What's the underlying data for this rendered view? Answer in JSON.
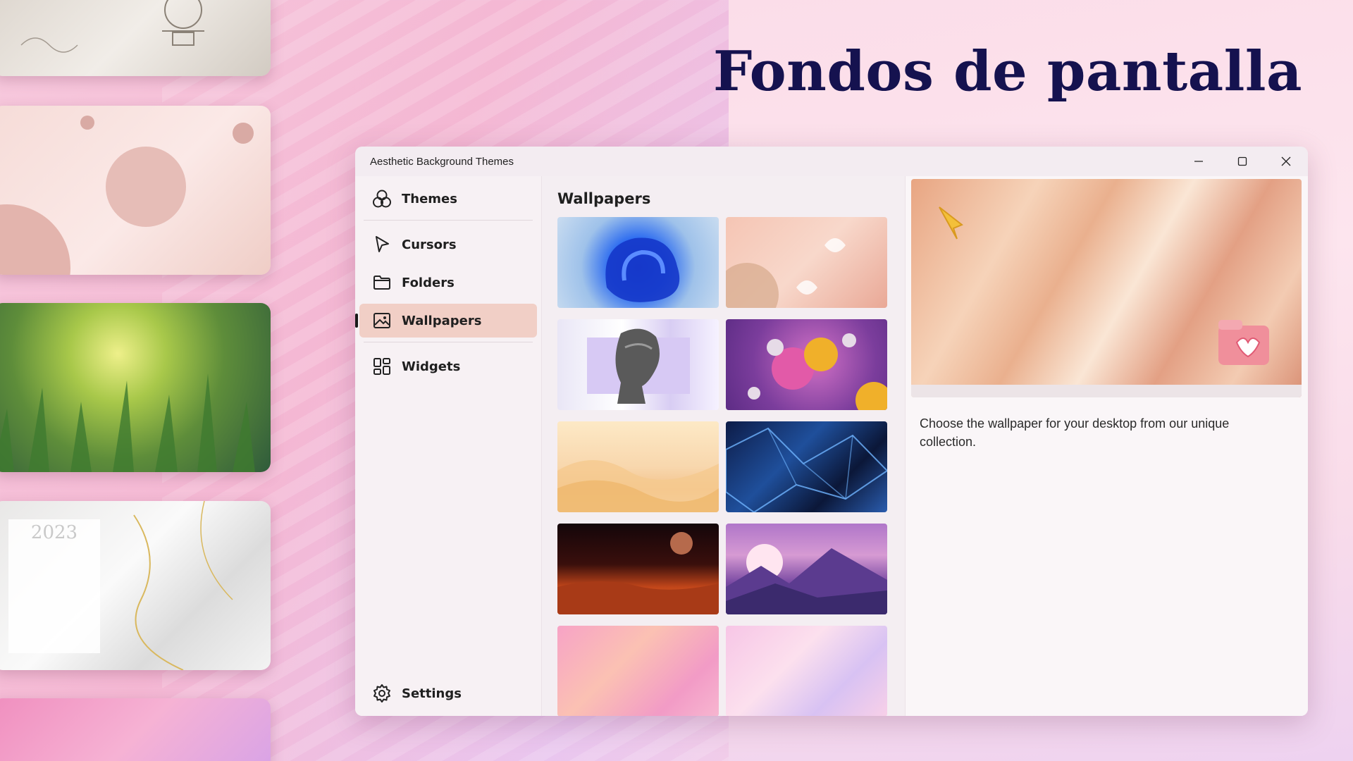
{
  "headline": "Fondos de pantalla",
  "window": {
    "title": "Aesthetic Background Themes",
    "controls": {
      "minimize": "minimize-icon",
      "maximize": "maximize-icon",
      "close": "close-icon"
    }
  },
  "nav": {
    "items": [
      {
        "label": "Themes",
        "icon": "themes-icon"
      },
      {
        "label": "Cursors",
        "icon": "cursor-icon"
      },
      {
        "label": "Folders",
        "icon": "folder-icon"
      },
      {
        "label": "Wallpapers",
        "icon": "image-icon",
        "active": true
      },
      {
        "label": "Widgets",
        "icon": "widgets-icon"
      }
    ],
    "settings": {
      "label": "Settings",
      "icon": "gear-icon"
    }
  },
  "content": {
    "heading": "Wallpapers"
  },
  "detail": {
    "description": "Choose the wallpaper for your desktop from our unique collection."
  },
  "side_cards": {
    "calendar_year": "2023"
  },
  "colors": {
    "headline": "#15124f",
    "active_nav": "#f1cfc6"
  }
}
